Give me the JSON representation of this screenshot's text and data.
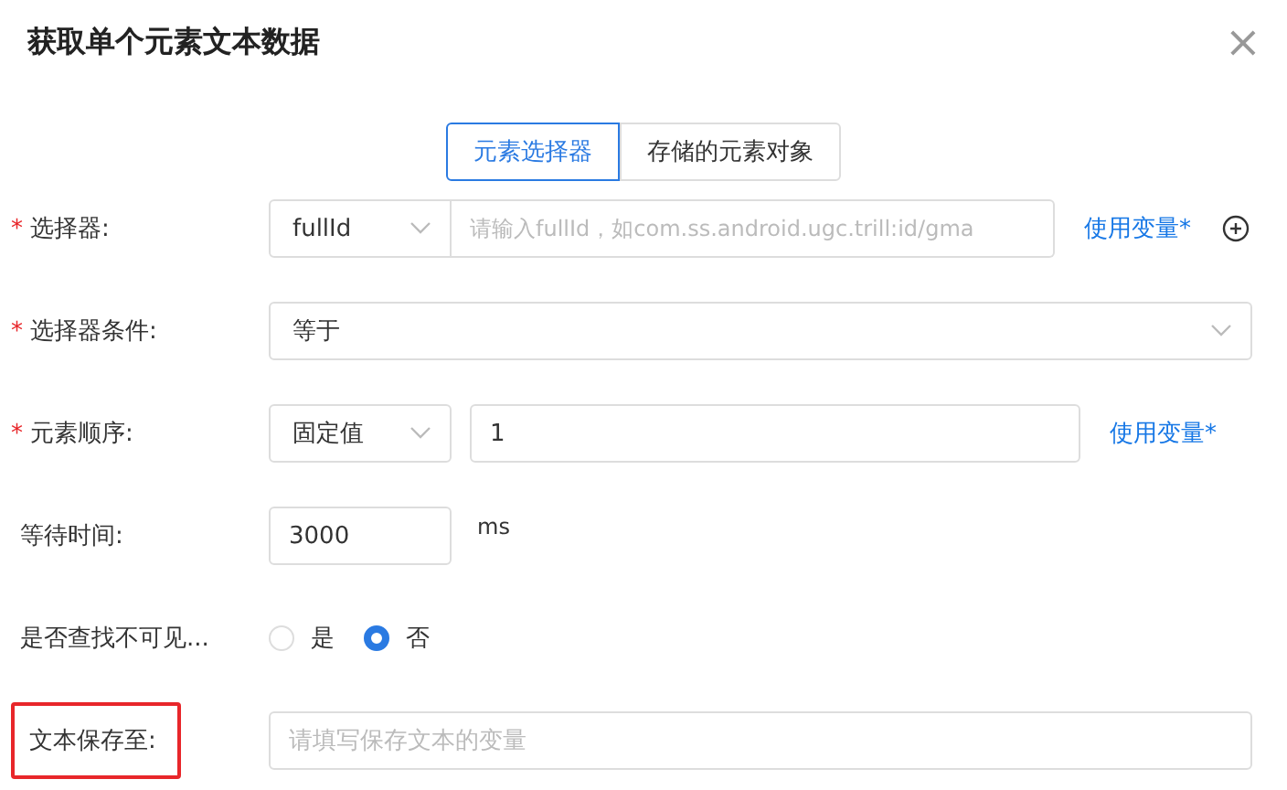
{
  "dialog": {
    "title": "获取单个元素文本数据",
    "close": "×"
  },
  "tabs": [
    {
      "label": "元素选择器",
      "selected": true
    },
    {
      "label": "存储的元素对象",
      "selected": false
    }
  ],
  "fields": [
    {
      "kind": "selector",
      "label": "选择器:",
      "required_mark": "*",
      "select": "fullId",
      "placeholder": "请输入fullId，如com.ss.android.ugc.trill:id/gma",
      "link": "使用变量*"
    },
    {
      "kind": "select",
      "label": "选择器条件:",
      "required_mark": "*",
      "select": "等于"
    },
    {
      "kind": "order",
      "label": "元素顺序:",
      "required_mark": "*",
      "select": "固定值",
      "value": "1",
      "link": "使用变量*"
    },
    {
      "kind": "number",
      "label": "等待时间:",
      "value": "3000",
      "unit": "ms"
    },
    {
      "kind": "radio",
      "label": "是否查找不可见...",
      "options": [
        {
          "label": "是",
          "selected": false
        },
        {
          "label": "否",
          "selected": true
        }
      ]
    },
    {
      "kind": "text",
      "label": "文本保存至:",
      "highlighted": true,
      "placeholder": "请填写保存文本的变量"
    }
  ]
}
